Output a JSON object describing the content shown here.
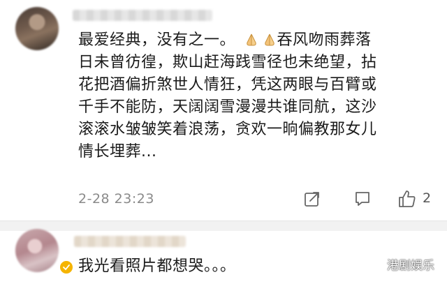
{
  "comments": [
    {
      "text_lines": [
        "最爱经典，没有之一。",
        "日未曾彷徨，欺山赶海践雪径也未绝望，拈",
        "花把酒偏折煞世人情狂，凭这两眼与百臂或",
        "千手不能防，天阔阔雪漫漫共谁同航，这沙",
        "滚滚水皱皱笑着浪荡，贪欢一晌偏教那女儿",
        "情长埋葬..."
      ],
      "after_emoji_text": "吞风吻雨葬落",
      "emoji": [
        "pray-emoji",
        "pray-emoji"
      ],
      "timestamp": "2-28 23:23",
      "like_count": "2"
    },
    {
      "text": "我光看照片都想哭。。。"
    }
  ],
  "watermark": {
    "text": "港剧娱乐"
  }
}
